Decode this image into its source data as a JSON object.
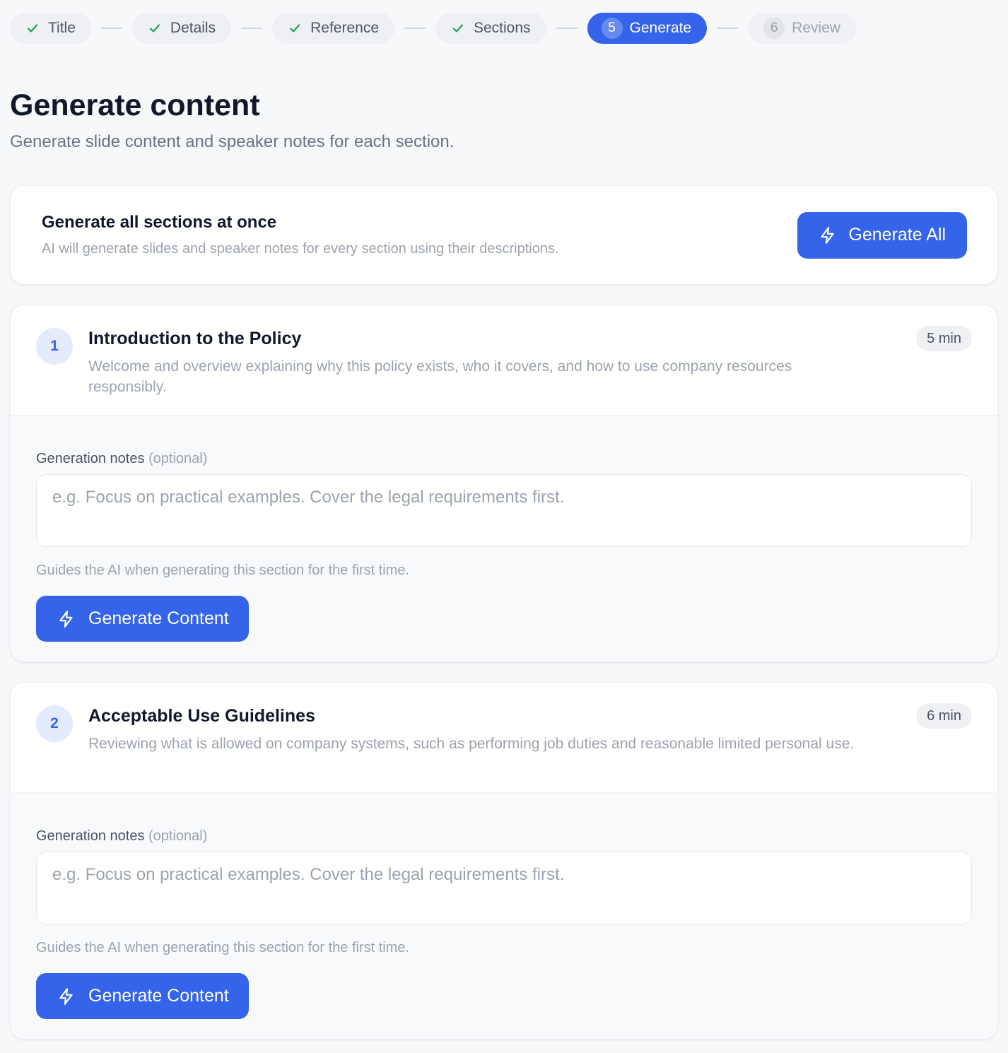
{
  "stepper": {
    "steps": [
      {
        "label": "Title",
        "state": "done"
      },
      {
        "label": "Details",
        "state": "done"
      },
      {
        "label": "Reference",
        "state": "done"
      },
      {
        "label": "Sections",
        "state": "done"
      },
      {
        "number": "5",
        "label": "Generate",
        "state": "active"
      },
      {
        "number": "6",
        "label": "Review",
        "state": "upcoming"
      }
    ]
  },
  "header": {
    "title": "Generate content",
    "subtitle": "Generate slide content and speaker notes for each section."
  },
  "generate_all": {
    "title": "Generate all sections at once",
    "description": "AI will generate slides and speaker notes for every section using their descriptions.",
    "button_label": "Generate All"
  },
  "sections": [
    {
      "number": "1",
      "title": "Introduction to the Policy",
      "description": "Welcome and overview explaining why this policy exists, who it covers, and how to use company resources responsibly.",
      "duration": "5 min",
      "notes_label": "Generation notes",
      "notes_optional": "(optional)",
      "notes_value": "",
      "notes_placeholder": "e.g. Focus on practical examples. Cover the legal requirements first.",
      "notes_help": "Guides the AI when generating this section for the first time.",
      "button_label": "Generate Content"
    },
    {
      "number": "2",
      "title": "Acceptable Use Guidelines",
      "description": "Reviewing what is allowed on company systems, such as performing job duties and reasonable limited personal use.",
      "duration": "6 min",
      "notes_label": "Generation notes",
      "notes_optional": "(optional)",
      "notes_value": "",
      "notes_placeholder": "e.g. Focus on practical examples. Cover the legal requirements first.",
      "notes_help": "Guides the AI when generating this section for the first time.",
      "button_label": "Generate Content"
    }
  ],
  "icons": {
    "step_done": "check-icon",
    "generate": "lightning-bolt-icon"
  },
  "colors": {
    "accent": "#3563e9",
    "check": "#22a05b",
    "background": "#f7f8fa"
  }
}
